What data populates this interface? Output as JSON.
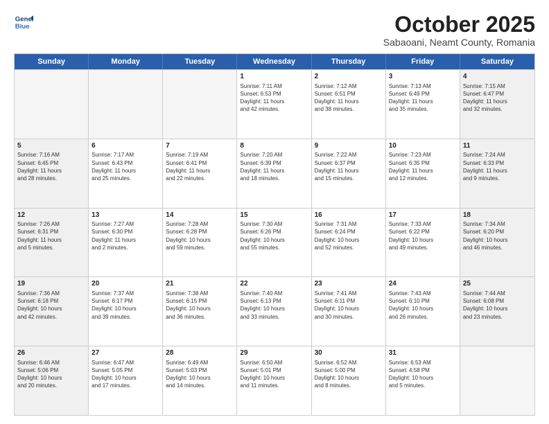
{
  "header": {
    "logo_line1": "General",
    "logo_line2": "Blue",
    "title": "October 2025",
    "subtitle": "Sabaoani, Neamt County, Romania"
  },
  "days_of_week": [
    "Sunday",
    "Monday",
    "Tuesday",
    "Wednesday",
    "Thursday",
    "Friday",
    "Saturday"
  ],
  "weeks": [
    [
      {
        "day": "",
        "info": "",
        "empty": true
      },
      {
        "day": "",
        "info": "",
        "empty": true
      },
      {
        "day": "",
        "info": "",
        "empty": true
      },
      {
        "day": "1",
        "info": "Sunrise: 7:11 AM\nSunset: 6:53 PM\nDaylight: 11 hours\nand 42 minutes."
      },
      {
        "day": "2",
        "info": "Sunrise: 7:12 AM\nSunset: 6:51 PM\nDaylight: 11 hours\nand 38 minutes."
      },
      {
        "day": "3",
        "info": "Sunrise: 7:13 AM\nSunset: 6:49 PM\nDaylight: 11 hours\nand 35 minutes."
      },
      {
        "day": "4",
        "info": "Sunrise: 7:15 AM\nSunset: 6:47 PM\nDaylight: 11 hours\nand 32 minutes.",
        "shaded": true
      }
    ],
    [
      {
        "day": "5",
        "info": "Sunrise: 7:16 AM\nSunset: 6:45 PM\nDaylight: 11 hours\nand 28 minutes.",
        "shaded": true
      },
      {
        "day": "6",
        "info": "Sunrise: 7:17 AM\nSunset: 6:43 PM\nDaylight: 11 hours\nand 25 minutes."
      },
      {
        "day": "7",
        "info": "Sunrise: 7:19 AM\nSunset: 6:41 PM\nDaylight: 11 hours\nand 22 minutes."
      },
      {
        "day": "8",
        "info": "Sunrise: 7:20 AM\nSunset: 6:39 PM\nDaylight: 11 hours\nand 18 minutes."
      },
      {
        "day": "9",
        "info": "Sunrise: 7:22 AM\nSunset: 6:37 PM\nDaylight: 11 hours\nand 15 minutes."
      },
      {
        "day": "10",
        "info": "Sunrise: 7:23 AM\nSunset: 6:35 PM\nDaylight: 11 hours\nand 12 minutes."
      },
      {
        "day": "11",
        "info": "Sunrise: 7:24 AM\nSunset: 6:33 PM\nDaylight: 11 hours\nand 9 minutes.",
        "shaded": true
      }
    ],
    [
      {
        "day": "12",
        "info": "Sunrise: 7:26 AM\nSunset: 6:31 PM\nDaylight: 11 hours\nand 5 minutes.",
        "shaded": true
      },
      {
        "day": "13",
        "info": "Sunrise: 7:27 AM\nSunset: 6:30 PM\nDaylight: 11 hours\nand 2 minutes."
      },
      {
        "day": "14",
        "info": "Sunrise: 7:28 AM\nSunset: 6:28 PM\nDaylight: 10 hours\nand 59 minutes."
      },
      {
        "day": "15",
        "info": "Sunrise: 7:30 AM\nSunset: 6:26 PM\nDaylight: 10 hours\nand 55 minutes."
      },
      {
        "day": "16",
        "info": "Sunrise: 7:31 AM\nSunset: 6:24 PM\nDaylight: 10 hours\nand 52 minutes."
      },
      {
        "day": "17",
        "info": "Sunrise: 7:33 AM\nSunset: 6:22 PM\nDaylight: 10 hours\nand 49 minutes."
      },
      {
        "day": "18",
        "info": "Sunrise: 7:34 AM\nSunset: 6:20 PM\nDaylight: 10 hours\nand 46 minutes.",
        "shaded": true
      }
    ],
    [
      {
        "day": "19",
        "info": "Sunrise: 7:36 AM\nSunset: 6:18 PM\nDaylight: 10 hours\nand 42 minutes.",
        "shaded": true
      },
      {
        "day": "20",
        "info": "Sunrise: 7:37 AM\nSunset: 6:17 PM\nDaylight: 10 hours\nand 39 minutes."
      },
      {
        "day": "21",
        "info": "Sunrise: 7:38 AM\nSunset: 6:15 PM\nDaylight: 10 hours\nand 36 minutes."
      },
      {
        "day": "22",
        "info": "Sunrise: 7:40 AM\nSunset: 6:13 PM\nDaylight: 10 hours\nand 33 minutes."
      },
      {
        "day": "23",
        "info": "Sunrise: 7:41 AM\nSunset: 6:11 PM\nDaylight: 10 hours\nand 30 minutes."
      },
      {
        "day": "24",
        "info": "Sunrise: 7:43 AM\nSunset: 6:10 PM\nDaylight: 10 hours\nand 26 minutes."
      },
      {
        "day": "25",
        "info": "Sunrise: 7:44 AM\nSunset: 6:08 PM\nDaylight: 10 hours\nand 23 minutes.",
        "shaded": true
      }
    ],
    [
      {
        "day": "26",
        "info": "Sunrise: 6:46 AM\nSunset: 5:06 PM\nDaylight: 10 hours\nand 20 minutes.",
        "shaded": true
      },
      {
        "day": "27",
        "info": "Sunrise: 6:47 AM\nSunset: 5:05 PM\nDaylight: 10 hours\nand 17 minutes."
      },
      {
        "day": "28",
        "info": "Sunrise: 6:49 AM\nSunset: 5:03 PM\nDaylight: 10 hours\nand 14 minutes."
      },
      {
        "day": "29",
        "info": "Sunrise: 6:50 AM\nSunset: 5:01 PM\nDaylight: 10 hours\nand 11 minutes."
      },
      {
        "day": "30",
        "info": "Sunrise: 6:52 AM\nSunset: 5:00 PM\nDaylight: 10 hours\nand 8 minutes."
      },
      {
        "day": "31",
        "info": "Sunrise: 6:53 AM\nSunset: 4:58 PM\nDaylight: 10 hours\nand 5 minutes."
      },
      {
        "day": "",
        "info": "",
        "empty": true
      }
    ]
  ]
}
